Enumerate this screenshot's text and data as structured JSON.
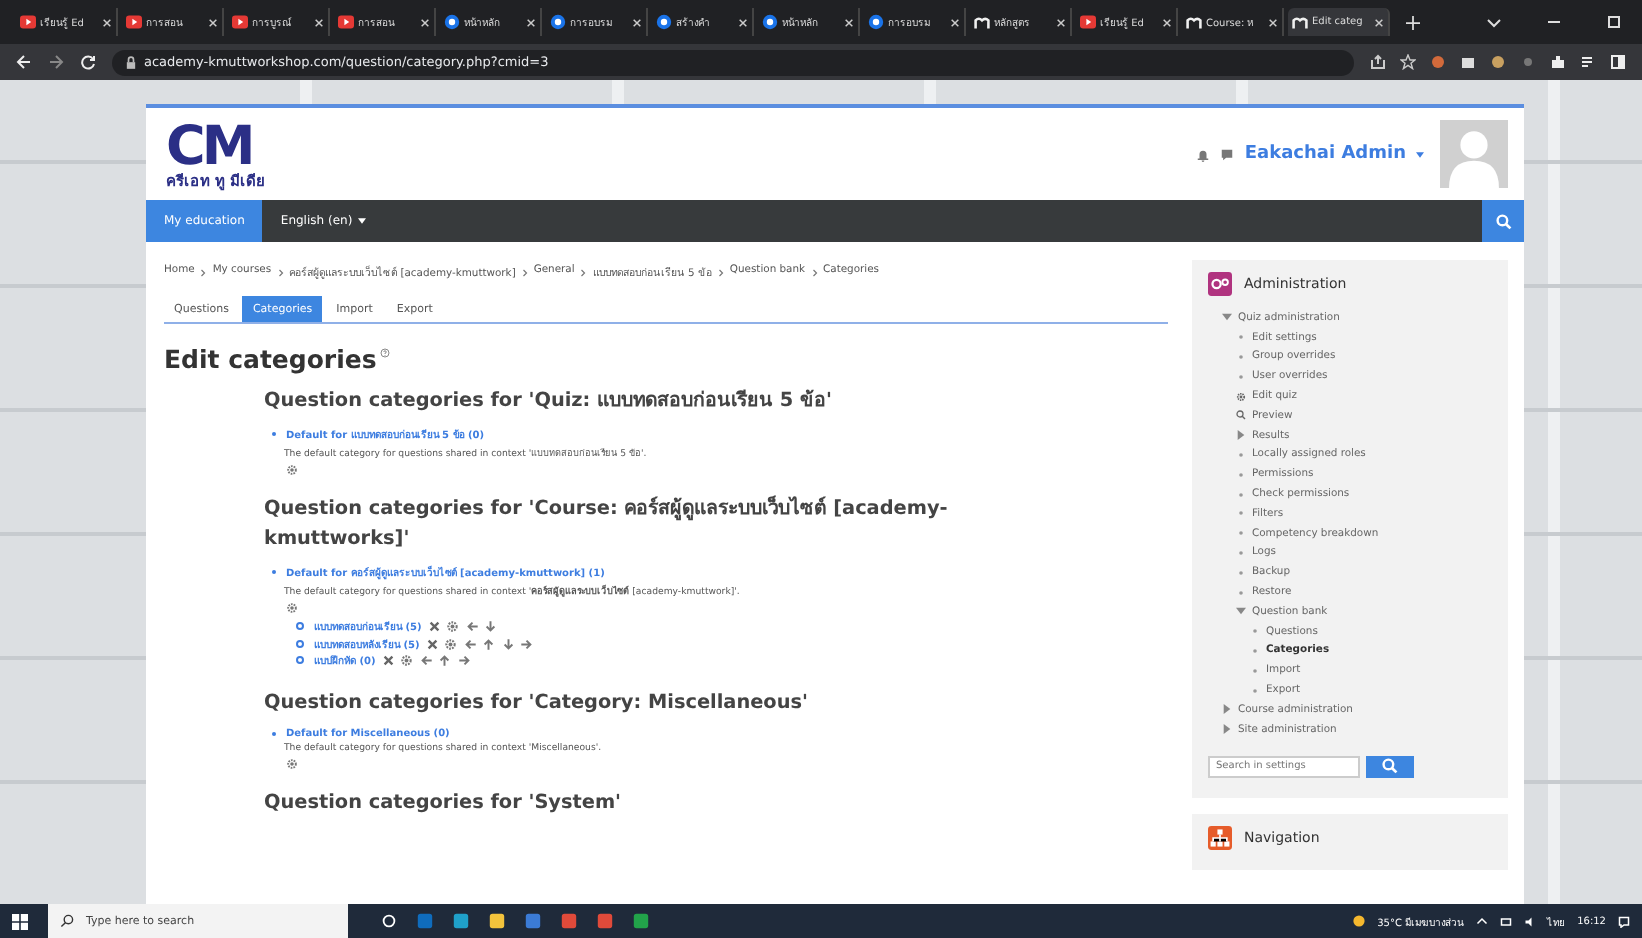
{
  "browser": {
    "tabs": [
      {
        "kind": "video",
        "title": "เรียนรู้ Ed",
        "selected": false
      },
      {
        "kind": "video",
        "title": "การสอน",
        "selected": false
      },
      {
        "kind": "video",
        "title": "การบูรณ์",
        "selected": false
      },
      {
        "kind": "video",
        "title": "การสอน",
        "selected": false
      },
      {
        "kind": "globe",
        "title": "หน้าหลัก",
        "selected": false
      },
      {
        "kind": "globe",
        "title": "การอบรม",
        "selected": false
      },
      {
        "kind": "globe",
        "title": "สร้างคำ",
        "selected": false
      },
      {
        "kind": "globe",
        "title": "หน้าหลัก",
        "selected": false
      },
      {
        "kind": "globe",
        "title": "การอบรม",
        "selected": false
      },
      {
        "kind": "moodle",
        "title": "หลักสูตร",
        "selected": false
      },
      {
        "kind": "video",
        "title": "เรียนรู้ Ed",
        "selected": false
      },
      {
        "kind": "moodle",
        "title": "Course: ห",
        "selected": false
      },
      {
        "kind": "moodle",
        "title": "Edit categ",
        "selected": true
      }
    ],
    "address": "academy-kmuttworkshop.com/question/category.php?cmid=3"
  },
  "site": {
    "logo_mark": "CM",
    "logo_text": "ครีเอท ทู มีเดีย",
    "user_name": "Eakachai Admin",
    "nav": [
      {
        "label": "My education",
        "selected": true,
        "dropdown": false
      },
      {
        "label": "English (en)",
        "selected": false,
        "dropdown": true
      }
    ]
  },
  "breadcrumb": [
    "Home",
    "My courses",
    "คอร์สผู้ดูแลระบบเว็บไซต์ [academy-kmuttwork]",
    "General",
    "แบบทดสอบก่อนเรียน 5 ข้อ",
    "Question bank",
    "Categories"
  ],
  "tabs": [
    {
      "label": "Questions",
      "selected": false
    },
    {
      "label": "Categories",
      "selected": true
    },
    {
      "label": "Import",
      "selected": false
    },
    {
      "label": "Export",
      "selected": false
    }
  ],
  "title": "Edit categories",
  "sections": [
    {
      "heading": "Question categories for 'Quiz: แบบทดสอบก่อนเรียน 5 ข้อ'",
      "categories": [
        {
          "name": "Default for แบบทดสอบก่อนเรียน 5 ข้อ (0)",
          "description": "The default category for questions shared in context 'แบบทดสอบก่อนเรียน 5 ข้อ'."
        }
      ]
    },
    {
      "heading": "Question categories for 'Course: คอร์สผู้ดูแลระบบเว็บไซต์ [academy-kmuttworks]'",
      "categories": [
        {
          "name": "Default for คอร์สผู้ดูแลระบบเว็บไซต์ [academy-kmuttwork] (1)",
          "description": "The default category for questions shared in context '**คอร์สผู้ดูแลระบบเว็บไซต์** [academy-kmuttwork]'.",
          "children": [
            {
              "name": "แบบทดสอบก่อนเรียน (5)",
              "actions": [
                {
                  "kind": "delete"
                },
                {
                  "kind": "edit"
                },
                {
                  "kind": "left"
                },
                {
                  "kind": "down"
                }
              ]
            },
            {
              "name": "แบบทดสอบหลังเรียน (5)",
              "actions": [
                {
                  "kind": "delete"
                },
                {
                  "kind": "edit"
                },
                {
                  "kind": "left"
                },
                {
                  "kind": "up"
                },
                {
                  "kind": "down"
                },
                {
                  "kind": "right"
                }
              ]
            },
            {
              "name": "แบบฝึกหัด (0)",
              "actions": [
                {
                  "kind": "delete"
                },
                {
                  "kind": "edit"
                },
                {
                  "kind": "left"
                },
                {
                  "kind": "up"
                },
                {
                  "kind": "right"
                }
              ]
            }
          ]
        }
      ]
    },
    {
      "heading": "Question categories for 'Category: Miscellaneous'",
      "categories": [
        {
          "name": "Default for Miscellaneous (0)",
          "description": "The default category for questions shared in context 'Miscellaneous'."
        }
      ]
    },
    {
      "heading": "Question categories for 'System'"
    }
  ],
  "admin": {
    "title": "Administration",
    "search_placeholder": "Search in settings",
    "tree": [
      {
        "label": "Quiz administration",
        "kind": "branch",
        "expanded": true,
        "selected": false,
        "children": [
          {
            "label": "Edit settings",
            "kind": "bullet",
            "selected": false
          },
          {
            "label": "Group overrides",
            "kind": "bullet",
            "selected": false
          },
          {
            "label": "User overrides",
            "kind": "bullet",
            "selected": false
          },
          {
            "label": "Edit quiz",
            "kind": "gear",
            "selected": false
          },
          {
            "label": "Preview",
            "kind": "search",
            "selected": false
          },
          {
            "label": "Results",
            "kind": "branch",
            "expanded": false,
            "selected": false
          },
          {
            "label": "Locally assigned roles",
            "kind": "bullet",
            "selected": false
          },
          {
            "label": "Permissions",
            "kind": "bullet",
            "selected": false
          },
          {
            "label": "Check permissions",
            "kind": "bullet",
            "selected": false
          },
          {
            "label": "Filters",
            "kind": "bullet",
            "selected": false
          },
          {
            "label": "Competency breakdown",
            "kind": "bullet",
            "selected": false
          },
          {
            "label": "Logs",
            "kind": "bullet",
            "selected": false
          },
          {
            "label": "Backup",
            "kind": "bullet",
            "selected": false
          },
          {
            "label": "Restore",
            "kind": "bullet",
            "selected": false
          },
          {
            "label": "Question bank",
            "kind": "branch",
            "expanded": true,
            "selected": false,
            "children": [
              {
                "label": "Questions",
                "kind": "bullet",
                "selected": false
              },
              {
                "label": "Categories",
                "kind": "bullet",
                "selected": true
              },
              {
                "label": "Import",
                "kind": "bullet",
                "selected": false
              },
              {
                "label": "Export",
                "kind": "bullet",
                "selected": false
              }
            ]
          }
        ]
      },
      {
        "label": "Course administration",
        "kind": "branch",
        "expanded": false,
        "selected": false
      },
      {
        "label": "Site administration",
        "kind": "branch",
        "expanded": false,
        "selected": false
      }
    ]
  },
  "navigation": {
    "title": "Navigation"
  },
  "taskbar": {
    "search_placeholder": "Type here to search",
    "apps": [
      {
        "kind": "task-view"
      },
      {
        "kind": "mail"
      },
      {
        "kind": "edge"
      },
      {
        "kind": "folder"
      },
      {
        "kind": "store"
      },
      {
        "kind": "chrome"
      },
      {
        "kind": "chrome"
      },
      {
        "kind": "contacts"
      }
    ],
    "weather": "35°C มีเมฆบางส่วน",
    "language": "ไทย",
    "time": "16:12"
  }
}
